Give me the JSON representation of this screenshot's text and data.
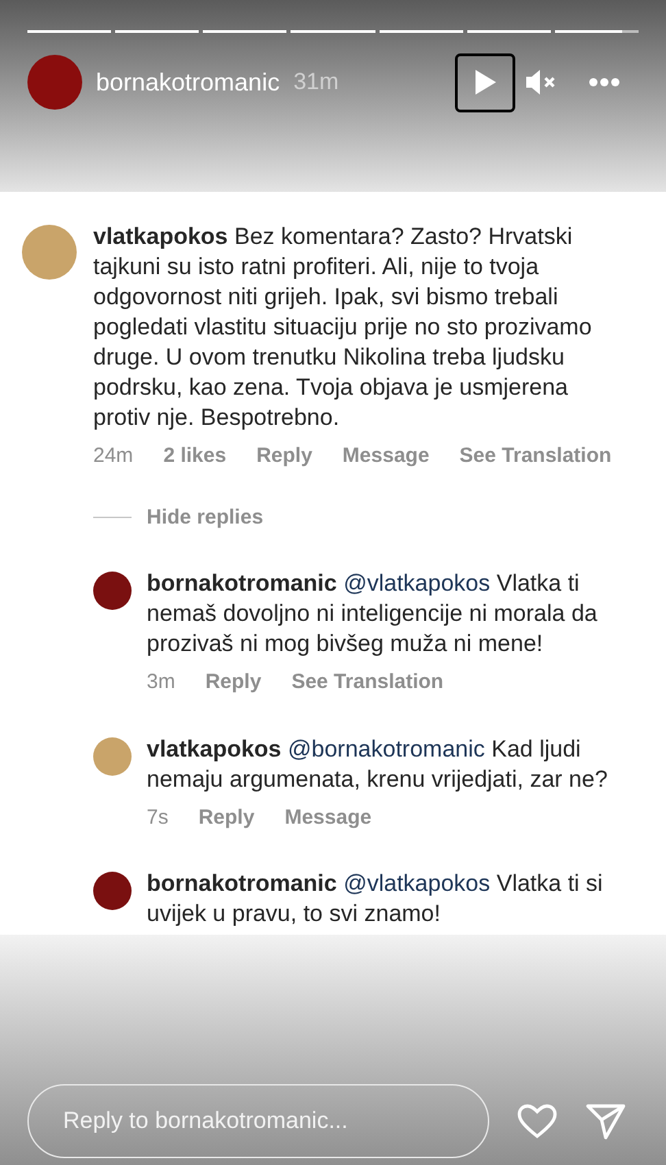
{
  "progress": [
    {
      "level": 1
    },
    {
      "level": 1
    },
    {
      "level": 1
    },
    {
      "level": 1
    },
    {
      "level": 1
    },
    {
      "level": 1
    },
    {
      "level": 0.8
    }
  ],
  "header": {
    "username": "bornakotromanic",
    "time": "31m",
    "playing": false,
    "muted": true
  },
  "comment": {
    "username": "vlatkapokos",
    "text": "Bez komentara? Zasto? Hrvatski tajkuni su isto ratni profiteri. Ali, nije to tvoja odgovornost niti grijeh. Ipak, svi bismo trebali pogledati vlastitu situaciju prije no sto prozivamo druge. U ovom trenutku Nikolina treba ljudsku podrsku, kao zena. Tvoja objava je usmjerena protiv nje. Bespotrebno.",
    "actions": [
      "24m",
      "2 likes",
      "Reply",
      "Message",
      "See Translation"
    ]
  },
  "hide_replies": "Hide replies",
  "replies": [
    {
      "username": "bornakotromanic",
      "color": "#7a1010",
      "mention": "@vlatkapokos",
      "text": "Vlatka ti nemaš dovoljno ni inteligencije ni morala da prozivaš ni mog bivšeg muža ni mene!",
      "actions": [
        "3m",
        "Reply",
        "See Translation"
      ]
    },
    {
      "username": "vlatkapokos",
      "color": "#c9a46a",
      "mention": "@bornakotromanic",
      "text": "Kad ljudi nemaju argumenata, krenu vrijedjati, zar ne?",
      "actions": [
        "7s",
        "Reply",
        "Message"
      ]
    },
    {
      "username": "bornakotromanic",
      "color": "#7a1010",
      "mention": "@vlatkapokos",
      "text": "Vlatka ti si uvijek u pravu, to svi znamo!"
    }
  ],
  "reply_field": {
    "placeholder": "Reply to bornakotromanic..."
  }
}
